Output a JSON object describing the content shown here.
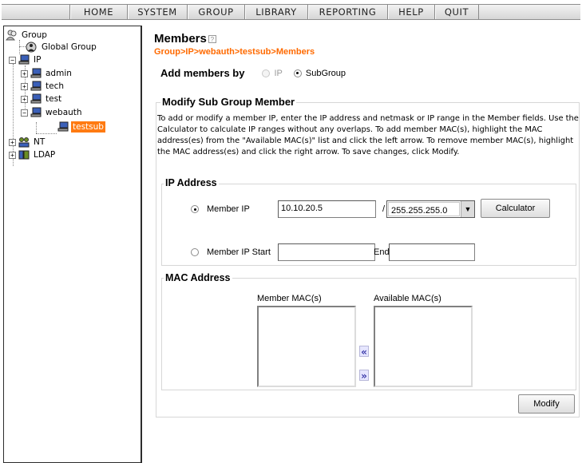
{
  "nav": {
    "items": [
      {
        "label": "HOME",
        "w": 72
      },
      {
        "label": "SYSTEM",
        "w": 75
      },
      {
        "label": "GROUP",
        "w": 72
      },
      {
        "label": "LIBRARY",
        "w": 79
      },
      {
        "label": "REPORTING",
        "w": 100
      },
      {
        "label": "HELP",
        "w": 59
      },
      {
        "label": "QUIT",
        "w": 55
      }
    ]
  },
  "tree": {
    "root": "Group",
    "global_group": "Global Group",
    "ip": "IP",
    "admin": "admin",
    "tech": "tech",
    "test": "test",
    "webauth": "webauth",
    "testsub": "testsub",
    "nt": "NT",
    "ldap": "LDAP"
  },
  "main": {
    "title": "Members",
    "help": "?",
    "breadcrumb": "Group>IP>webauth>testsub>Members",
    "add_by_label": "Add members by",
    "option_ip": "IP",
    "option_subgroup": "SubGroup",
    "section_title": "Modify Sub Group Member",
    "description": "To add or modify a member IP, enter the IP address and netmask or IP range in the Member fields. Use the Calculator to calculate IP ranges without any overlaps. To add member MAC(s), highlight the MAC address(es) from the \"Available MAC(s)\" list and click the left arrow. To remove member MAC(s), highlight the MAC address(es) and click the right arrow. To save changes, click Modify."
  },
  "ip_section": {
    "title": "IP Address",
    "member_ip_label": "Member IP",
    "member_ip_value": "10.10.20.5",
    "slash": "/",
    "netmask": "255.255.255.0",
    "calculator": "Calculator",
    "member_ip_start_label": "Member IP Start",
    "member_ip_start_value": "",
    "end_label": "End",
    "end_value": ""
  },
  "mac_section": {
    "title": "MAC Address",
    "member_macs_label": "Member MAC(s)",
    "available_macs_label": "Available MAC(s)",
    "add_arrow": "«",
    "remove_arrow": "»"
  },
  "actions": {
    "modify": "Modify"
  },
  "colors": {
    "breadcrumb": "#ff6a00",
    "selected_node": "#ff7b12",
    "arrow": "#3a39a8"
  }
}
